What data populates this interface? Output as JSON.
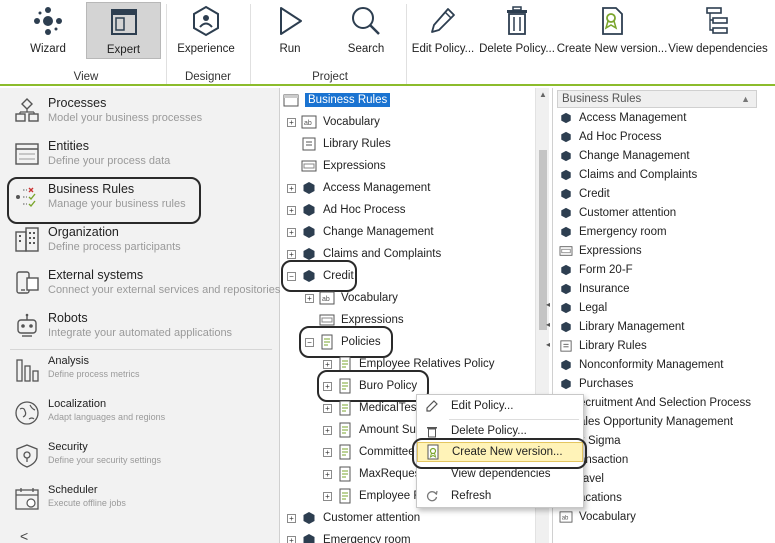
{
  "ribbon": {
    "buttons": {
      "wizard": "Wizard",
      "expert": "Expert",
      "experience": "Experience",
      "run": "Run",
      "search": "Search",
      "edit_policy": "Edit Policy...",
      "delete_policy": "Delete Policy...",
      "create_new_version": "Create New version...",
      "view_dependencies": "View dependencies"
    },
    "groups": {
      "view": "View",
      "designer": "Designer",
      "project": "Project"
    },
    "accent_color": "#8cbc2c"
  },
  "leftnav": {
    "items": [
      {
        "title": "Processes",
        "desc": "Model your business processes"
      },
      {
        "title": "Entities",
        "desc": "Define your process data"
      },
      {
        "title": "Business Rules",
        "desc": "Manage your business rules"
      },
      {
        "title": "Organization",
        "desc": "Define process participants"
      },
      {
        "title": "External systems",
        "desc": "Connect your external services and repositories"
      },
      {
        "title": "Robots",
        "desc": "Integrate your automated applications"
      },
      {
        "title": "Analysis",
        "desc": "Define process metrics"
      },
      {
        "title": "Localization",
        "desc": "Adapt languages and regions"
      },
      {
        "title": "Security",
        "desc": "Define your security settings"
      },
      {
        "title": "Scheduler",
        "desc": "Execute offline jobs"
      }
    ],
    "back": "<"
  },
  "tree": {
    "root": "Business Rules",
    "nodes": {
      "vocabulary": "Vocabulary",
      "library_rules": "Library Rules",
      "expressions": "Expressions",
      "access_management": "Access Management",
      "ad_hoc_process": "Ad Hoc Process",
      "change_management": "Change Management",
      "claims_and_complaints": "Claims and Complaints",
      "credit": "Credit",
      "credit_vocabulary": "Vocabulary",
      "credit_expressions": "Expressions",
      "policies": "Policies",
      "employee_relatives_policy": "Employee Relatives Policy",
      "buro_policy": "Buro Policy",
      "medical_test": "MedicalTes",
      "amount_su": "Amount Su",
      "committee": "Committee",
      "max_reques": "MaxReques",
      "employee_f": "Employee F",
      "customer_attention": "Customer attention",
      "emergency_room": "Emergency room"
    }
  },
  "context_menu": {
    "edit_policy": "Edit Policy...",
    "delete_policy": "Delete Policy...",
    "create_new_version": "Create New version...",
    "view_dependencies": "View dependencies",
    "refresh": "Refresh",
    "highlight_color": "#fff3b8"
  },
  "rightlist": {
    "header": "Business Rules",
    "items": [
      "Access Management",
      "Ad Hoc Process",
      "Change Management",
      "Claims and Complaints",
      "Credit",
      "Customer attention",
      "Emergency room",
      "Expressions",
      "Form 20-F",
      "Insurance",
      "Legal",
      "Library Management",
      "Library Rules",
      "Nonconformity Management",
      "Purchases",
      "ecruitment And Selection Process",
      "ales Opportunity Management",
      "x Sigma",
      "ansaction",
      "ravel",
      "acations",
      "Vocabulary"
    ]
  }
}
